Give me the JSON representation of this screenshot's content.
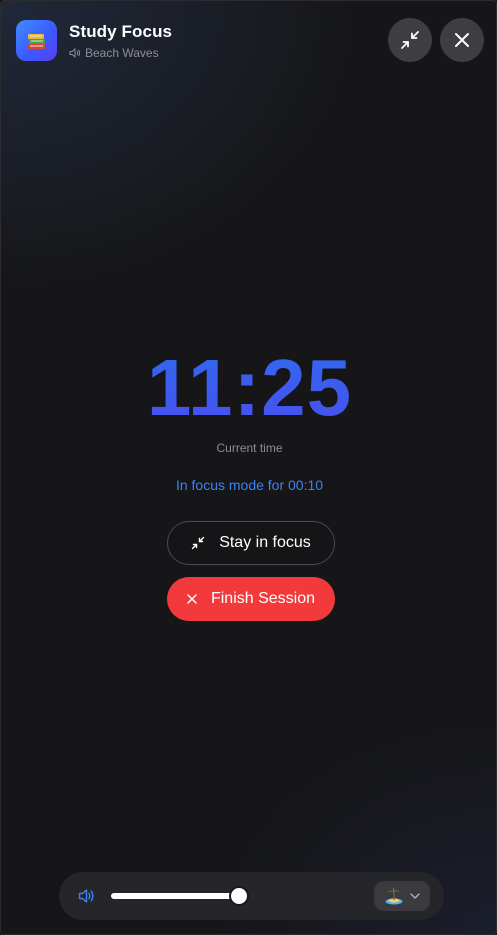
{
  "header": {
    "app_title": "Study Focus",
    "sound_name": "Beach Waves",
    "app_icon": "books-icon",
    "minimize_icon": "minimize-icon",
    "close_icon": "close-icon"
  },
  "main": {
    "current_time": "11:25",
    "time_caption": "Current time",
    "focus_status": "In focus mode for 00:10",
    "stay_button_label": "Stay in focus",
    "finish_button_label": "Finish Session"
  },
  "controls": {
    "volume_level_percent": 100,
    "volume_icon": "speaker-icon",
    "scene_icon": "island-icon",
    "scene_chevron": "chevron-down-icon"
  },
  "colors": {
    "accent_blue": "#3b82f6",
    "clock_blue": "#3a5cf0",
    "finish_red": "#f23a3c",
    "background": "#161618",
    "button_grey": "#3e3e42"
  }
}
